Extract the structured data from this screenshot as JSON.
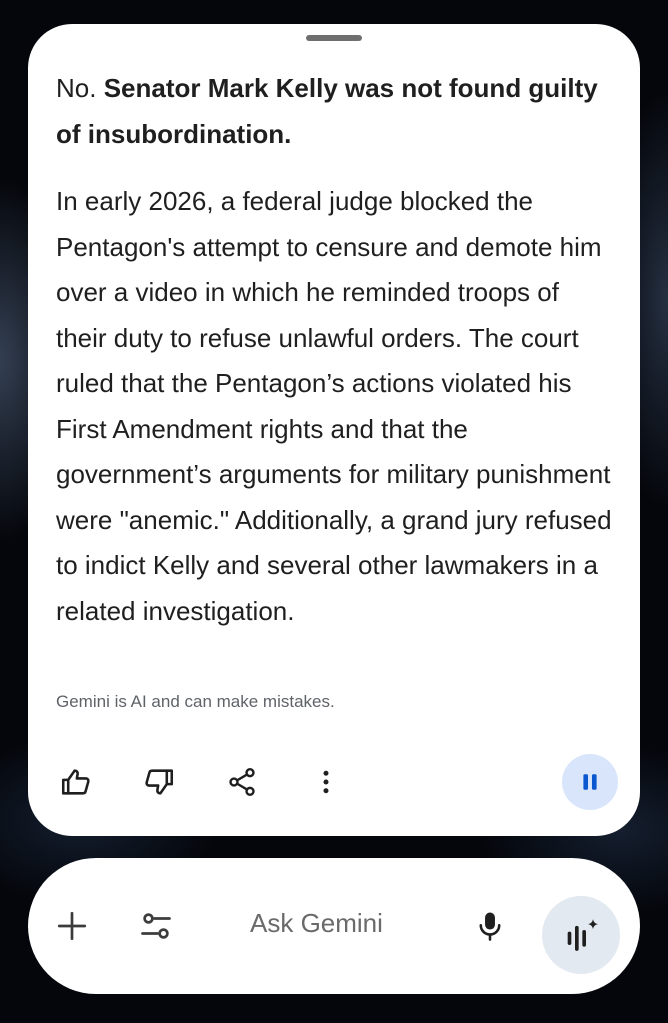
{
  "response": {
    "lead_prefix": "No. ",
    "lead_bold": "Senator Mark Kelly was not found guilty of insubordination.",
    "body": "In early 2026, a federal judge blocked the Pentagon's attempt to censure and demote him over a video in which he reminded troops of their duty to refuse unlawful orders. The court ruled that the Pentagon’s actions violated his First Amendment rights and that the government’s arguments for military punishment were \"anemic.\" Additionally, a grand jury refused to indict Kelly and several other lawmakers in a related investigation.",
    "disclaimer": "Gemini is AI and can make mistakes."
  },
  "actions": {
    "icons": [
      "thumbs-up-icon",
      "thumbs-down-icon",
      "share-icon",
      "more-vert-icon",
      "pause-icon"
    ]
  },
  "input_bar": {
    "placeholder": "Ask Gemini",
    "icons": [
      "plus-icon",
      "tune-icon",
      "mic-icon",
      "gemini-live-icon"
    ]
  },
  "colors": {
    "card": "#ffffff",
    "text": "#1f1f1f",
    "muted": "#5f6368",
    "pause_bg": "#d8e5fb",
    "pause_fg": "#0b57d0",
    "live_bg": "#e3e9f1"
  }
}
